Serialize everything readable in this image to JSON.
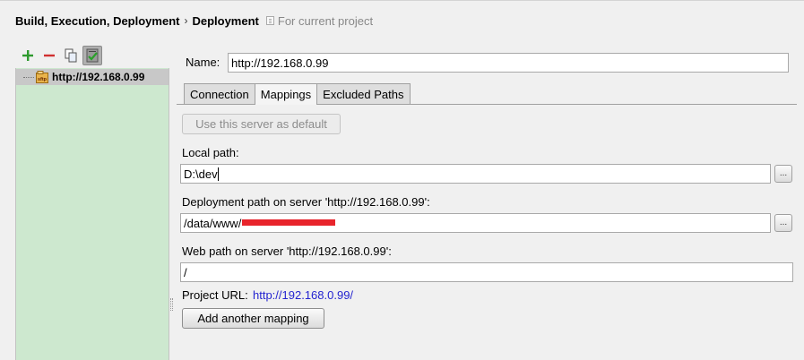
{
  "breadcrumb": {
    "parent": "Build, Execution, Deployment",
    "separator": "›",
    "current": "Deployment",
    "scope_icon": "project-scope-icon",
    "scope_text": "For current project"
  },
  "toolbar": {
    "add_icon": "plus-icon",
    "remove_icon": "minus-icon",
    "copy_icon": "copy-icon",
    "default_icon": "use-as-default-icon"
  },
  "tree": {
    "items": [
      {
        "icon": "sftp-server-icon",
        "icon_text": "sftp",
        "label": "http://192.168.0.99"
      }
    ]
  },
  "form": {
    "name_label": "Name:",
    "name_value": "http://192.168.0.99",
    "tabs": [
      {
        "label": "Connection",
        "selected": false
      },
      {
        "label": "Mappings",
        "selected": true
      },
      {
        "label": "Excluded Paths",
        "selected": false
      }
    ],
    "use_default_label": "Use this server as default",
    "local_path_label": "Local path:",
    "local_path_value": "D:\\dev",
    "deployment_path_label": "Deployment path on server 'http://192.168.0.99':",
    "deployment_path_value": "/data/www/",
    "web_path_label": "Web path on server 'http://192.168.0.99':",
    "web_path_value": "/",
    "project_url_label": "Project URL:",
    "project_url_value": "http://192.168.0.99/",
    "add_mapping_label": "Add another mapping",
    "browse_label": "..."
  },
  "colors": {
    "tree_background": "#cde8cf",
    "selected_row": "#c8c8c8",
    "link": "#2424d0",
    "redaction": "#e8242b",
    "add_green": "#2e9a2e",
    "remove_red": "#d03030"
  }
}
